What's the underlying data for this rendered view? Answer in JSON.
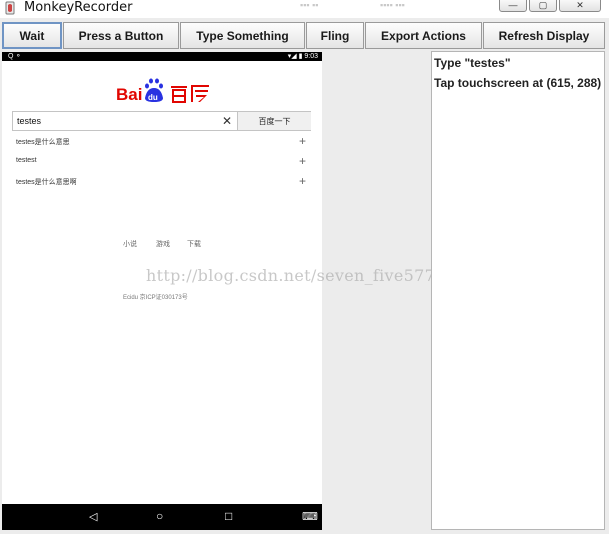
{
  "window": {
    "title": "MonkeyRecorder",
    "minimize": "—",
    "maximize": "▢",
    "close": "✕"
  },
  "toolbar": [
    {
      "label": "Wait",
      "name": "wait-button"
    },
    {
      "label": "Press a Button",
      "name": "press-a-button-button"
    },
    {
      "label": "Type Something",
      "name": "type-something-button"
    },
    {
      "label": "Fling",
      "name": "fling-button"
    },
    {
      "label": "Export Actions",
      "name": "export-actions-button"
    },
    {
      "label": "Refresh Display",
      "name": "refresh-display-button"
    }
  ],
  "device": {
    "status": {
      "left": "Q  ⚬",
      "right": "▾◢ ▮ 9:03"
    },
    "search": {
      "value": "testes",
      "clear": "✕",
      "button": "百度一下"
    },
    "suggestions": [
      {
        "text": "testes是什么意思",
        "plus": "+"
      },
      {
        "text": "testest",
        "plus": "+"
      },
      {
        "text": "testes是什么意思啊",
        "plus": "+"
      }
    ],
    "nav_links": [
      "小说",
      "游戏",
      "下载"
    ],
    "footer": "Ecidu 京ICP证030173号",
    "navbar": {
      "back": "◁",
      "home": "○",
      "recent": "□",
      "keyboard": "⌨"
    }
  },
  "actions": [
    "Type \"testes\"",
    "Tap touchscreen at (615, 288)"
  ],
  "watermark": "http://blog.csdn.net/seven_five577",
  "colors": {
    "accent_border": "#6f94c4",
    "baidu_red": "#e10601",
    "baidu_blue": "#2932e1"
  }
}
